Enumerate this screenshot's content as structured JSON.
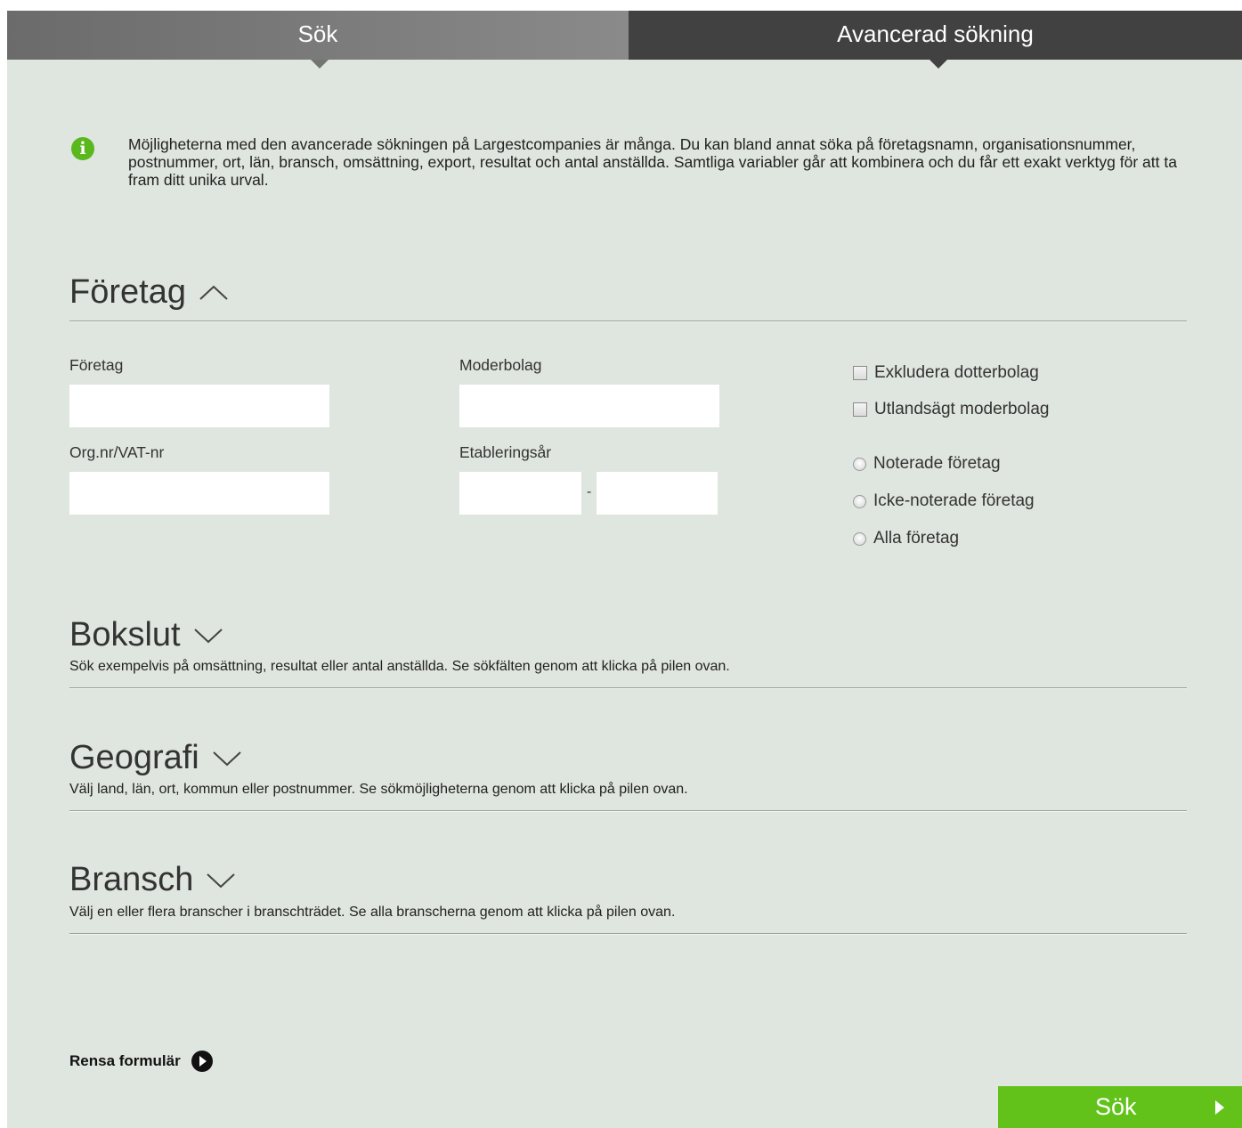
{
  "tabs": [
    {
      "label": "Sök"
    },
    {
      "label": "Avancerad sökning"
    }
  ],
  "info": {
    "icon": "info-icon",
    "text": "Möjligheterna med den avancerade sökningen på Largestcompanies är många. Du kan bland annat söka på företagsnamn, organisationsnummer, postnummer, ort, län, bransch, omsättning, export, resultat och antal anställda. Samtliga variabler går att kombinera och du får ett exakt verktyg för att ta fram ditt unika urval."
  },
  "sections": {
    "foretag": {
      "title": "Företag",
      "chevron": "chevron-up-icon"
    },
    "bokslut": {
      "title": "Bokslut",
      "chevron": "chevron-down-icon",
      "desc": "Sök exempelvis på omsättning, resultat eller antal anställda. Se sökfälten genom att klicka på pilen ovan."
    },
    "geografi": {
      "title": "Geografi",
      "chevron": "chevron-down-icon",
      "desc": "Välj land, län, ort, kommun eller postnummer. Se sökmöjligheterna genom att klicka på pilen ovan."
    },
    "bransch": {
      "title": "Bransch",
      "chevron": "chevron-down-icon",
      "desc": "Välj en eller flera branscher i branschträdet. Se alla branscherna genom att klicka på pilen ovan."
    }
  },
  "form": {
    "company_label": "Företag",
    "company_value": "",
    "parent_label": "Moderbolag",
    "parent_value": "",
    "orgnr_label": "Org.nr/VAT-nr",
    "orgnr_value": "",
    "year_label": "Etableringsår",
    "year_from": "",
    "year_to": "",
    "year_separator": "-",
    "checkboxes": [
      {
        "label": "Exkludera dotterbolag",
        "checked": false
      },
      {
        "label": "Utlandsägt moderbolag",
        "checked": false
      }
    ],
    "radios": [
      {
        "label": "Noterade företag",
        "selected": false
      },
      {
        "label": "Icke-noterade företag",
        "selected": false
      },
      {
        "label": "Alla företag",
        "selected": false
      }
    ]
  },
  "actions": {
    "reset_label": "Rensa formulär",
    "reset_icon": "arrow-right-circle-icon",
    "submit_label": "Sök",
    "submit_icon": "arrow-right-icon"
  },
  "colors": {
    "background": "#dfe5df",
    "tab_active": "#414141",
    "accent_green": "#62c21a",
    "info_green": "#5ab81e"
  }
}
